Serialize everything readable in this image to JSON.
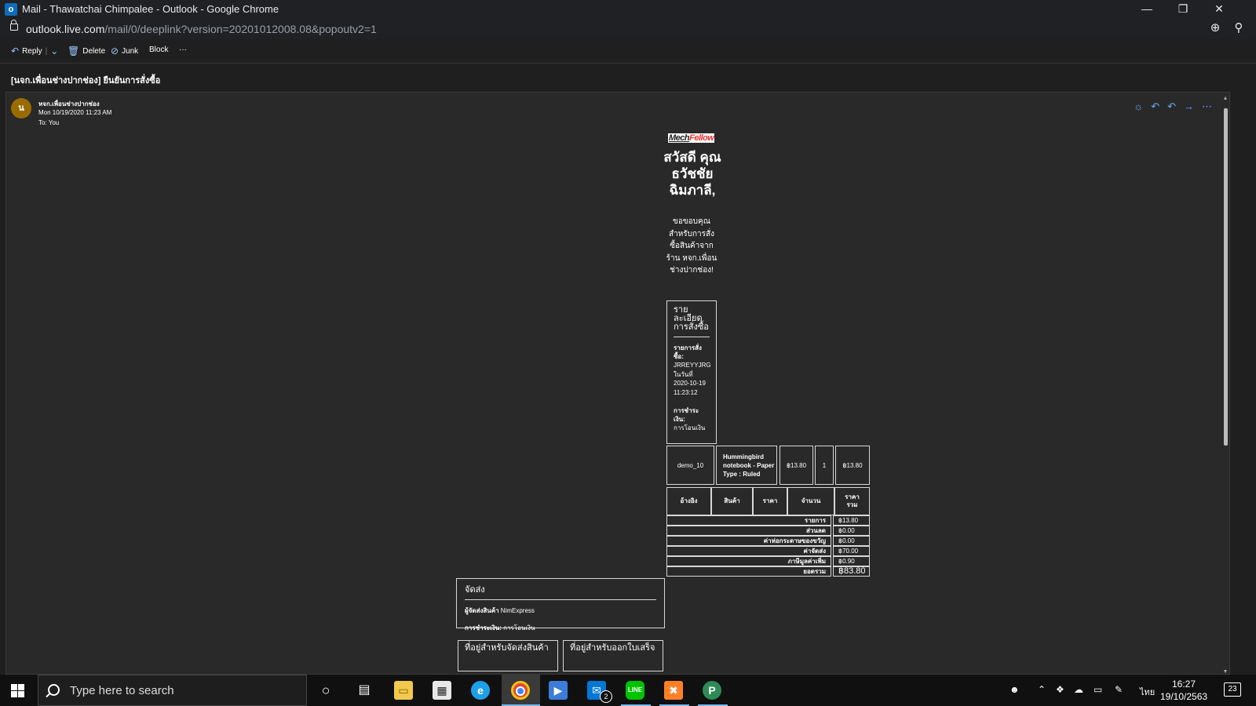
{
  "window": {
    "app_icon_letter": "o",
    "title": "Mail - Thawatchai Chimpalee - Outlook - Google Chrome"
  },
  "browser": {
    "url_host": "outlook.live.com",
    "url_path": "/mail/0/deeplink?version=20201012008.08&popoutv2=1"
  },
  "toolbar": {
    "reply": "Reply",
    "delete": "Delete",
    "junk": "Junk",
    "block": "Block",
    "more": "···"
  },
  "message": {
    "subject": "[นจก.เพื่อนช่างปากช่อง] ยืนยันการสั่งซื้อ",
    "avatar_letter": "น",
    "sender": "หจก.เพื่อนช่างปากช่อง",
    "date": "Mon 10/19/2020 11:23 AM",
    "to": "To: You"
  },
  "email": {
    "logo_part1": "Mech",
    "logo_part2": "Fellow",
    "greeting": "สวัสดี คุณ ธวัชชัย ฉิมภาลี,",
    "thanks": "ขอขอบคุณสำหรับการสั่งซื้อสินค้าจากร้าน หจก.เพื่อนช่างปากช่อง!",
    "order_details": {
      "heading": "รายละเอียดการสั่งซื้อ",
      "order_label": "รายการสั่งซื้อ:",
      "order_ref": "JRREYYJRG",
      "order_date_prefix": "ในวันที่",
      "order_date": "2020-10-19",
      "order_time": "11:23:12",
      "payment_label": "การชำระเงิน:",
      "payment_value": "การโอนเงิน"
    },
    "item": {
      "reference": "demo_10",
      "product": "Hummingbird notebook - Paper Type : Ruled",
      "price": "฿13.80",
      "quantity": "1",
      "total": "฿13.80"
    },
    "columns": [
      "อ้างอิง",
      "สินค้า",
      "ราคา",
      "จำนวน",
      "ราคารวม"
    ],
    "totals": [
      {
        "label": "รายการ",
        "value": "฿13.80"
      },
      {
        "label": "ส่วนลด",
        "value": "฿0.00"
      },
      {
        "label": "ค่าห่อกระดาษของขวัญ",
        "value": "฿0.00"
      },
      {
        "label": "ค่าจัดส่ง",
        "value": "฿70.00"
      },
      {
        "label": "ภาษีมูลค่าเพิ่ม",
        "value": "฿0.90"
      },
      {
        "label": "ยอดรวม",
        "value": "฿83.80"
      }
    ],
    "shipping": {
      "heading": "จัดส่ง",
      "carrier_label": "ผู้จัดส่งสินค้า",
      "carrier_value": "NimExpress",
      "payment_label": "การชำระเงิน:",
      "payment_value": "การโอนเงิน"
    },
    "delivery_address_heading": "ที่อยู่สำหรับจัดส่งสินค้า",
    "invoice_address_heading": "ที่อยู่สำหรับออกใบเสร็จ"
  },
  "taskbar": {
    "search_placeholder": "Type here to search",
    "mail_badge": "2",
    "language": "ไทย",
    "time": "16:27",
    "date": "19/10/2563",
    "notification_count": "23"
  },
  "colors": {
    "accent": "#76b9ed",
    "outlook_blue": "#0f6cbd",
    "logo_red": "#e8312e"
  }
}
